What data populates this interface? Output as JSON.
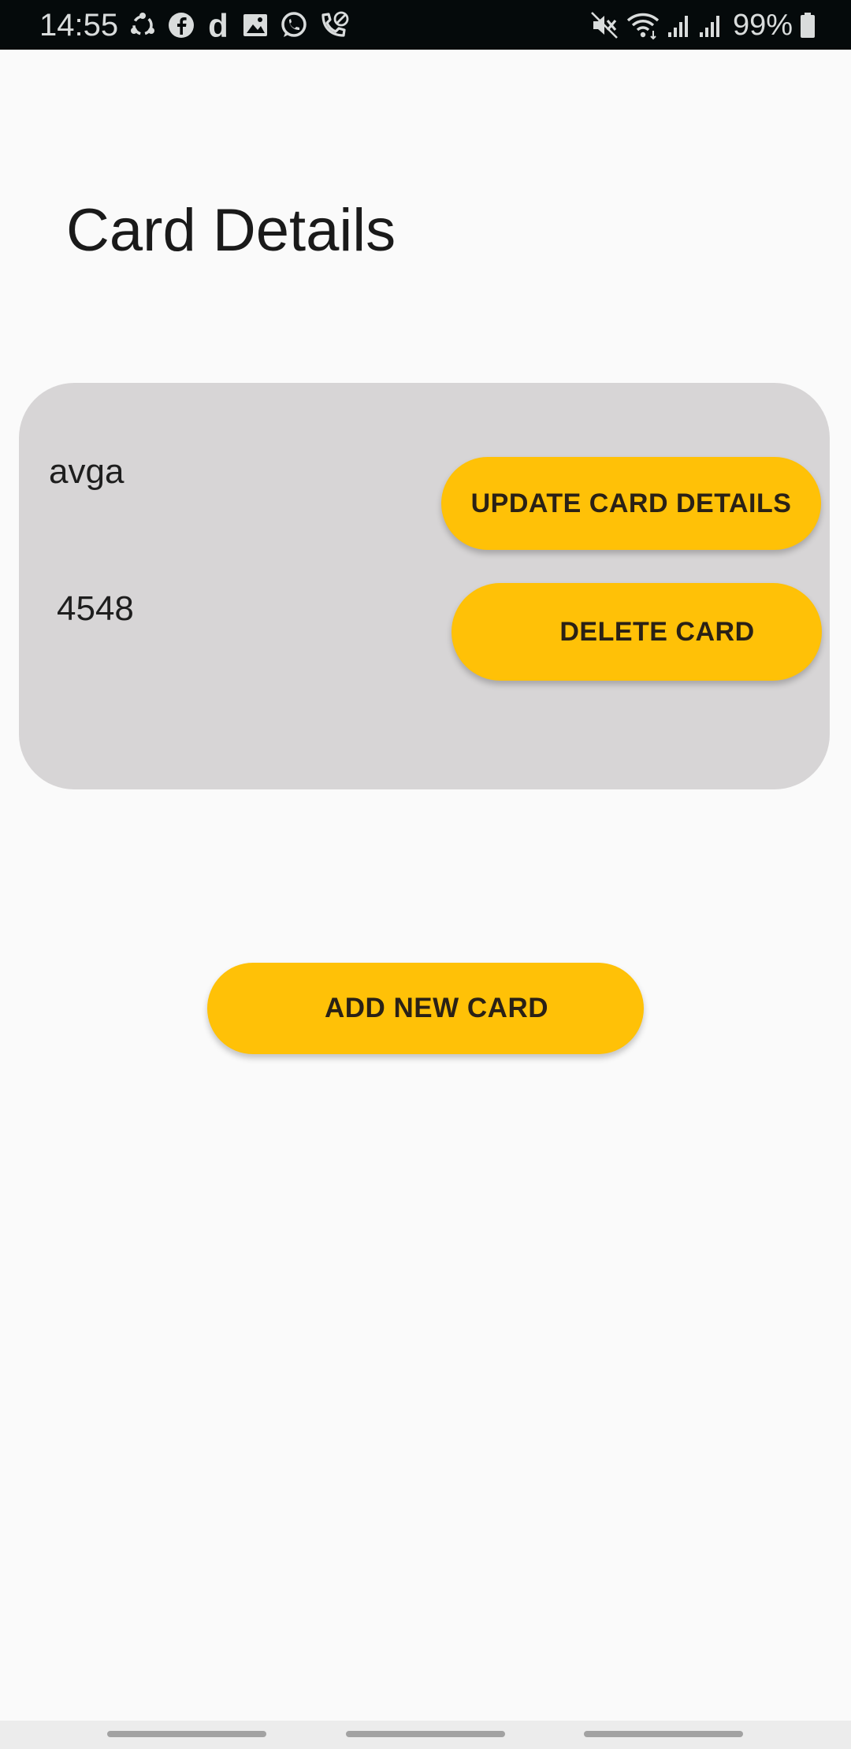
{
  "status_bar": {
    "time": "14:55",
    "notification_icons": [
      "sync-icon",
      "facebook-icon",
      "dailyhunt-icon",
      "gallery-icon",
      "whatsapp-icon",
      "wifi-calling-icon"
    ],
    "system_icons": [
      "mute-icon",
      "wifi-icon",
      "signal-icon",
      "signal-icon"
    ],
    "battery": "99%"
  },
  "page": {
    "title": "Card Details"
  },
  "card": {
    "name": "avga",
    "number": "4548",
    "update_label": "UPDATE CARD DETAILS",
    "delete_label": "DELETE CARD"
  },
  "actions": {
    "add_label": "ADD NEW CARD"
  },
  "colors": {
    "accent": "#ffc107",
    "card_background": "#d7d5d6",
    "page_background": "#fafafa",
    "status_bar": "#050a0b"
  }
}
